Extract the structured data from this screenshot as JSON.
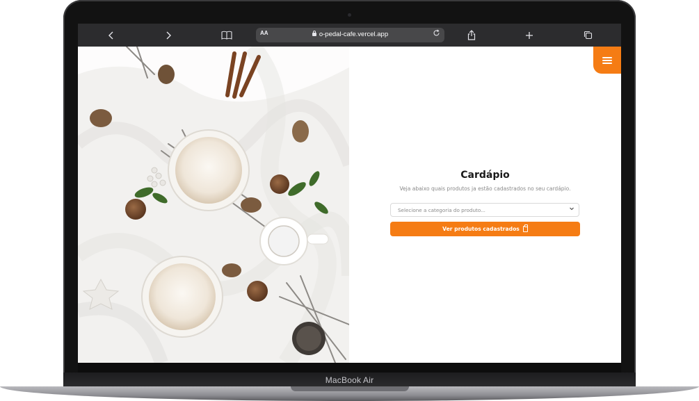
{
  "device": {
    "label": "MacBook Air"
  },
  "browser": {
    "address_small": "AA",
    "url": "o-pedal-cafe.vercel.app"
  },
  "page": {
    "title": "Cardápio",
    "subtitle": "Veja abaixo quais produtos ja estão cadastrados no seu cardápio.",
    "select_placeholder": "Selecione a categoria do produto...",
    "button_label": "Ver produtos cadastrados"
  },
  "colors": {
    "accent": "#f57c14",
    "toolbar": "#2c2c2e"
  },
  "icons": [
    "back-icon",
    "forward-icon",
    "book-icon",
    "lock-icon",
    "reload-icon",
    "share-icon",
    "plus-icon",
    "tabs-icon",
    "hamburger-icon",
    "clipboard-icon",
    "chevron-down-icon"
  ]
}
